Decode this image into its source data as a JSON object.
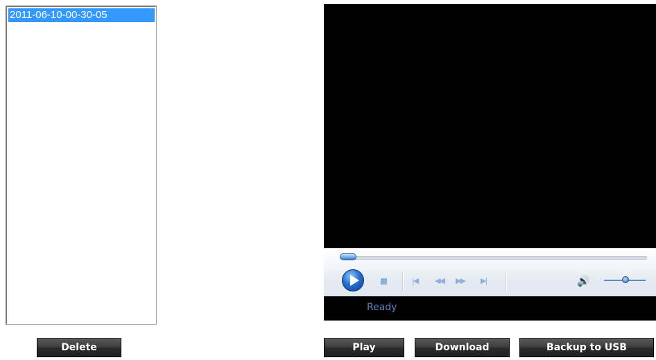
{
  "recordings": {
    "items": [
      {
        "label": "2011-06-10-00-30-05",
        "selected": true
      }
    ]
  },
  "buttons": {
    "delete": "Delete",
    "play": "Play",
    "download": "Download",
    "backup": "Backup to USB"
  },
  "player": {
    "status": "Ready",
    "seek_fraction": 0.0,
    "volume_fraction": 0.5,
    "icons": {
      "play": "play-icon",
      "stop": "stop-icon",
      "previous": "skip-previous-icon",
      "rewind": "rewind-icon",
      "fast_forward": "fast-forward-icon",
      "next": "skip-next-icon",
      "volume": "volume-icon"
    }
  },
  "colors": {
    "selection": "#3399ff",
    "button_bg": "#3a3a3a",
    "video_bg": "#000000",
    "status_text": "#5b83c9",
    "control_icon": "#8ab0dc"
  }
}
